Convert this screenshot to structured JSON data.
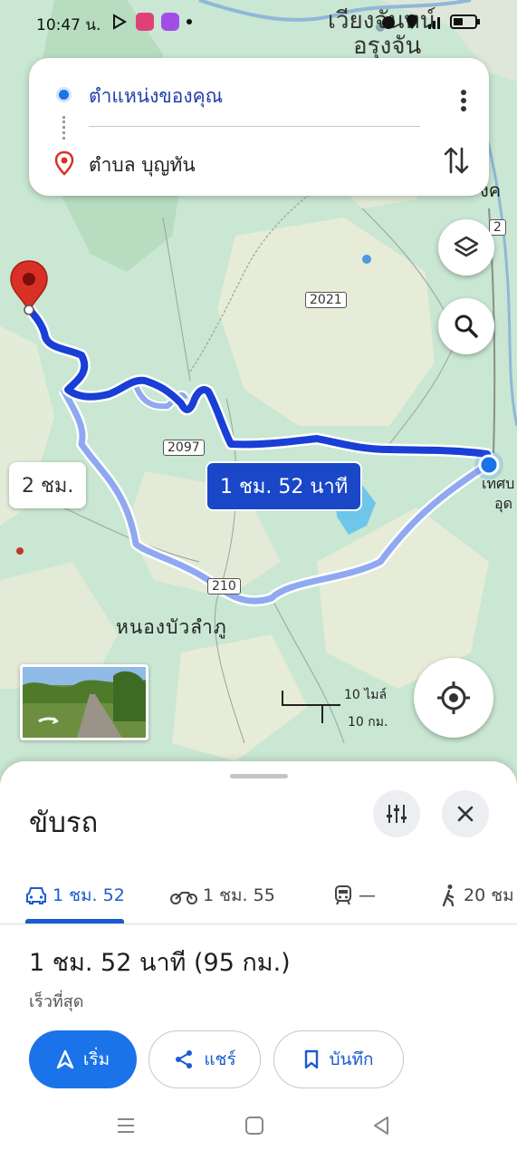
{
  "status_bar": {
    "time": "10:47 น.",
    "battery_icon": "battery-icon"
  },
  "directions": {
    "origin": "ตำแหน่งของคุณ",
    "destination": "ตำบล บุญทัน"
  },
  "map": {
    "route_main_label": "1 ชม. 52 นาที",
    "route_alt_label": "2 ชม.",
    "place_labels": {
      "town_top": "เวียงจันทน์",
      "town_top_2": "อรุงจัน",
      "village": "หนองบัวลำภู",
      "right_edge_1": "เทศบ",
      "right_edge_2": "อุด",
      "right_top_edge": "งค"
    },
    "road_shields": {
      "r2021": "2021",
      "r2097": "2097",
      "r210": "210",
      "r2": "2"
    },
    "scale": {
      "miles": "10 ไมล์",
      "km": "10 กม."
    },
    "colors": {
      "route_main": "#1a3fd6",
      "route_alt": "#8fa8f0",
      "map_green": "#c9e7d2",
      "destination_pin": "#d93025"
    }
  },
  "sheet": {
    "title": "ขับรถ",
    "tabs": [
      {
        "icon": "car-icon",
        "label": "1 ชม. 52",
        "active": true
      },
      {
        "icon": "motorcycle-icon",
        "label": "1 ชม. 55",
        "active": false
      },
      {
        "icon": "train-icon",
        "label": "—",
        "active": false
      },
      {
        "icon": "walk-icon",
        "label": "20 ชม",
        "active": false
      }
    ],
    "summary": "1 ชม. 52 นาที (95 กม.)",
    "subtitle": "เร็วที่สุด",
    "buttons": {
      "start": "เริ่ม",
      "share": "แชร์",
      "save": "บันทึก"
    }
  }
}
